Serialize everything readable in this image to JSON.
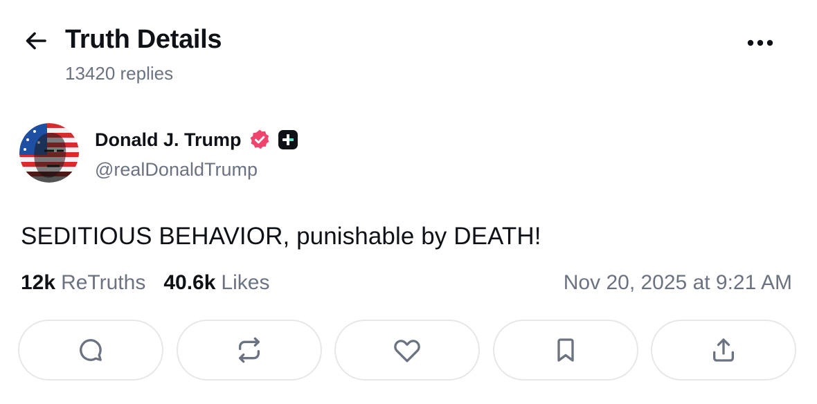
{
  "header": {
    "title": "Truth Details",
    "replies": "13420 replies",
    "back_icon": "arrow-left-icon",
    "more_icon": "more-horizontal-icon"
  },
  "post": {
    "author_name": "Donald J. Trump",
    "handle": "@realDonaldTrump",
    "verified_color": "#f0446f",
    "text": "SEDITIOUS BEHAVIOR, punishable by DEATH!",
    "retruths_count": "12k",
    "retruths_label": "ReTruths",
    "likes_count": "40.6k",
    "likes_label": "Likes",
    "timestamp": "Nov 20, 2025 at 9:21 AM"
  },
  "actions": [
    {
      "name": "reply",
      "icon": "comment-icon"
    },
    {
      "name": "retruth",
      "icon": "repeat-icon"
    },
    {
      "name": "like",
      "icon": "heart-icon"
    },
    {
      "name": "bookmark",
      "icon": "bookmark-icon"
    },
    {
      "name": "share",
      "icon": "upload-icon"
    }
  ]
}
